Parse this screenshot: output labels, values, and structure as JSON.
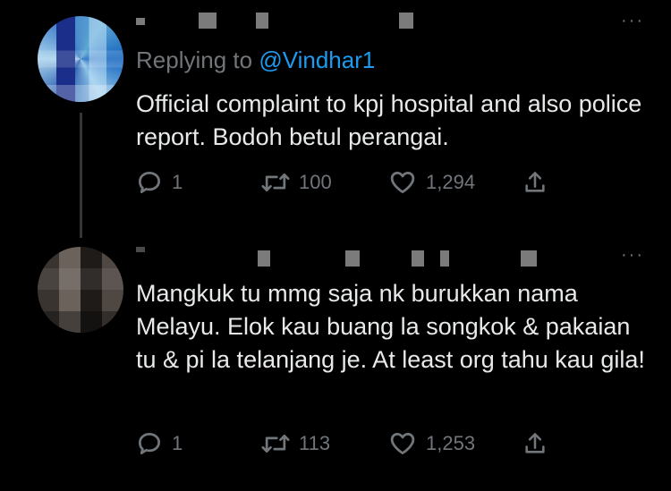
{
  "tweets": [
    {
      "replying_prefix": "Replying to",
      "replying_handle": "@Vindhar1",
      "text": "Official complaint to kpj hospital and also police report. Bodoh betul perangai.",
      "replies": "1",
      "retweets": "100",
      "likes": "1,294",
      "more": "···"
    },
    {
      "text": "Mangkuk tu mmg saja nk burukkan nama Melayu. Elok kau buang la songkok & pakaian tu & pi la telanjang je. At least org tahu kau gila!",
      "replies": "1",
      "retweets": "113",
      "likes": "1,253",
      "more": "···"
    }
  ],
  "colors": {
    "background": "#000000",
    "text": "#e7e9ea",
    "muted": "#71767b",
    "link": "#1d9bf0"
  },
  "icons": [
    "reply-icon",
    "retweet-icon",
    "like-icon",
    "share-icon",
    "more-icon"
  ]
}
